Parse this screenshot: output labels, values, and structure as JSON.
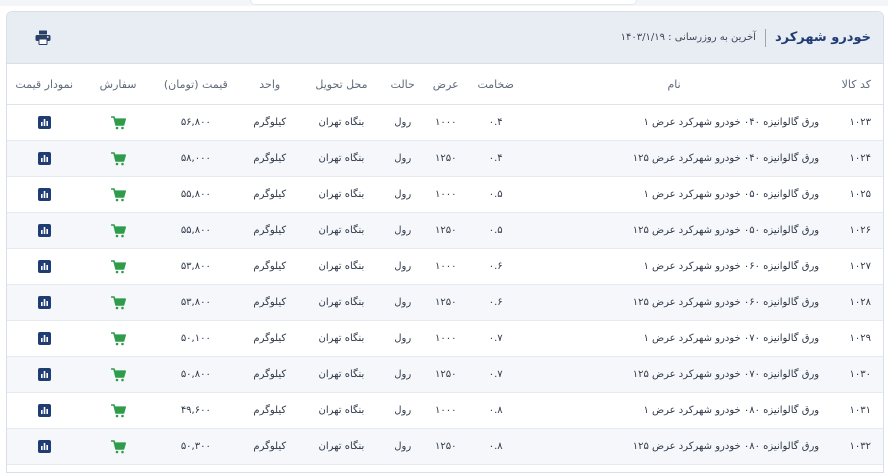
{
  "header": {
    "title": "خودرو شهرکرد",
    "updated": "آخرین به روزرسانی : ۱۴۰۳/۱/۱۹"
  },
  "columns": {
    "code": "کد کالا",
    "name": "نام",
    "thickness": "ضخامت",
    "width": "عرض",
    "state": "حالت",
    "place": "محل تحویل",
    "unit": "واحد",
    "price": "قیمت (تومان)",
    "order": "سفارش",
    "chart": "نمودار قیمت"
  },
  "rows": [
    {
      "code": "۱۰۲۳",
      "name": "ورق گالوانیزه ۰۴۰ خودرو شهرکرد عرض ۱",
      "thickness": "۰.۴",
      "width": "۱۰۰۰",
      "state": "رول",
      "place": "بنگاه تهران",
      "unit": "کیلوگرم",
      "price": "۵۶,۸۰۰"
    },
    {
      "code": "۱۰۲۴",
      "name": "ورق گالوانیزه ۰۴۰ خودرو شهرکرد عرض ۱۲۵",
      "thickness": "۰.۴",
      "width": "۱۲۵۰",
      "state": "رول",
      "place": "بنگاه تهران",
      "unit": "کیلوگرم",
      "price": "۵۸,۰۰۰"
    },
    {
      "code": "۱۰۲۵",
      "name": "ورق گالوانیزه ۰۵۰ خودرو شهرکرد عرض ۱",
      "thickness": "۰.۵",
      "width": "۱۰۰۰",
      "state": "رول",
      "place": "بنگاه تهران",
      "unit": "کیلوگرم",
      "price": "۵۵,۸۰۰"
    },
    {
      "code": "۱۰۲۶",
      "name": "ورق گالوانیزه ۰۵۰ خودرو شهرکرد عرض ۱۲۵",
      "thickness": "۰.۵",
      "width": "۱۲۵۰",
      "state": "رول",
      "place": "بنگاه تهران",
      "unit": "کیلوگرم",
      "price": "۵۵,۸۰۰"
    },
    {
      "code": "۱۰۲۷",
      "name": "ورق گالوانیزه ۰۶۰ خودرو شهرکرد عرض ۱",
      "thickness": "۰.۶",
      "width": "۱۰۰۰",
      "state": "رول",
      "place": "بنگاه تهران",
      "unit": "کیلوگرم",
      "price": "۵۳,۸۰۰"
    },
    {
      "code": "۱۰۲۸",
      "name": "ورق گالوانیزه ۰۶۰ خودرو شهرکرد عرض ۱۲۵",
      "thickness": "۰.۶",
      "width": "۱۲۵۰",
      "state": "رول",
      "place": "بنگاه تهران",
      "unit": "کیلوگرم",
      "price": "۵۳,۸۰۰"
    },
    {
      "code": "۱۰۲۹",
      "name": "ورق گالوانیزه ۰۷۰ خودرو شهرکرد عرض ۱",
      "thickness": "۰.۷",
      "width": "۱۰۰۰",
      "state": "رول",
      "place": "بنگاه تهران",
      "unit": "کیلوگرم",
      "price": "۵۰,۱۰۰"
    },
    {
      "code": "۱۰۳۰",
      "name": "ورق گالوانیزه ۰۷۰ خودرو شهرکرد عرض ۱۲۵",
      "thickness": "۰.۷",
      "width": "۱۲۵۰",
      "state": "رول",
      "place": "بنگاه تهران",
      "unit": "کیلوگرم",
      "price": "۵۰,۸۰۰"
    },
    {
      "code": "۱۰۳۱",
      "name": "ورق گالوانیزه ۰۸۰ خودرو شهرکرد عرض ۱",
      "thickness": "۰.۸",
      "width": "۱۰۰۰",
      "state": "رول",
      "place": "بنگاه تهران",
      "unit": "کیلوگرم",
      "price": "۴۹,۶۰۰"
    },
    {
      "code": "۱۰۳۲",
      "name": "ورق گالوانیزه ۰۸۰ خودرو شهرکرد عرض ۱۲۵",
      "thickness": "۰.۸",
      "width": "۱۲۵۰",
      "state": "رول",
      "place": "بنگاه تهران",
      "unit": "کیلوگرم",
      "price": "۵۰,۳۰۰"
    }
  ],
  "icons": {
    "print": "printer-icon",
    "order": "cart-icon",
    "chart": "bar-chart-icon"
  },
  "colors": {
    "header_bg": "#e8edf4",
    "title": "#1f3c73",
    "cart": "#2e9c4a",
    "chart_icon": "#1f3c73",
    "print_icon": "#2a3f66"
  }
}
